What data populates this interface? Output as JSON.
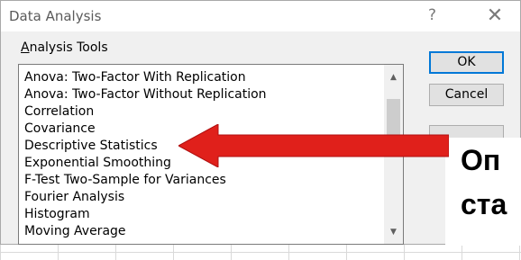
{
  "window": {
    "title": "Data Analysis",
    "help_glyph": "?",
    "close_glyph": "✕"
  },
  "tools": {
    "label_access_key": "A",
    "label_rest": "nalysis Tools",
    "items": [
      "Anova: Two-Factor With Replication",
      "Anova: Two-Factor Without Replication",
      "Correlation",
      "Covariance",
      "Descriptive Statistics",
      "Exponential Smoothing",
      "F-Test Two-Sample for Variances",
      "Fourier Analysis",
      "Histogram",
      "Moving Average"
    ],
    "scroll_up_glyph": "▲",
    "scroll_down_glyph": "▼"
  },
  "buttons": {
    "ok": "OK",
    "cancel": "Cancel"
  },
  "annotation": {
    "line1": "Оп",
    "line2": "ста",
    "arrow_color": "#e0201b"
  }
}
